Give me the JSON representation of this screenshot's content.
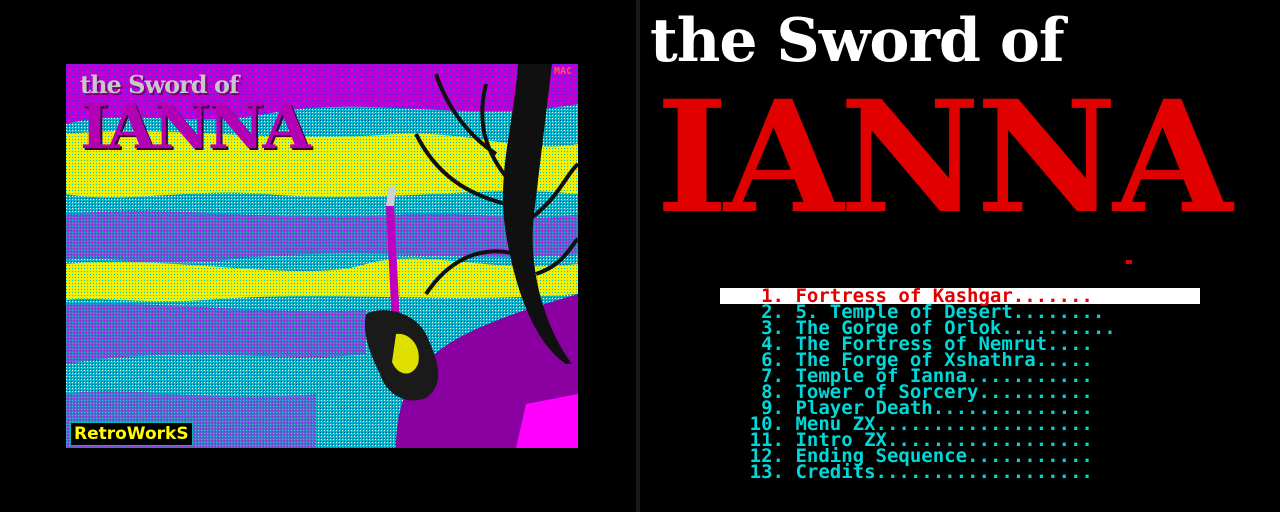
{
  "left_panel": {
    "art_title_small": "the Sword of",
    "art_title_big": "IANNA",
    "corner_mark": "MAC",
    "publisher_logo": "RetroWorkS"
  },
  "right_panel": {
    "title_top": "the Sword of",
    "title_main": "IANNA"
  },
  "menu": {
    "items": [
      {
        "num": "1.",
        "name": "Fortress of Kashgar",
        "dots": ".......",
        "selected": true
      },
      {
        "num": "2.",
        "name": "5. Temple of Desert",
        "dots": "........",
        "selected": false
      },
      {
        "num": "3.",
        "name": "The Gorge of Orlok",
        "dots": "..........",
        "selected": false
      },
      {
        "num": "4.",
        "name": "The Fortress of Nemrut",
        "dots": "....",
        "selected": false
      },
      {
        "num": "6.",
        "name": "The Forge of Xshathra",
        "dots": ".....",
        "selected": false
      },
      {
        "num": "7.",
        "name": "Temple of Ianna",
        "dots": "...........",
        "selected": false
      },
      {
        "num": "8.",
        "name": "Tower of Sorcery",
        "dots": "..........",
        "selected": false
      },
      {
        "num": "9.",
        "name": "Player Death",
        "dots": "..............",
        "selected": false
      },
      {
        "num": "10.",
        "name": "Menu ZX",
        "dots": "...................",
        "selected": false
      },
      {
        "num": "11.",
        "name": "Intro ZX",
        "dots": "..................",
        "selected": false
      },
      {
        "num": "12.",
        "name": "Ending Sequence",
        "dots": "...........",
        "selected": false
      },
      {
        "num": "13.",
        "name": "Credits",
        "dots": "...................",
        "selected": false
      }
    ]
  },
  "colors": {
    "background": "#000000",
    "title_red": "#e00000",
    "menu_cyan": "#00d8d8",
    "selection_bg": "#ffffff",
    "art_magenta": "#d400d4",
    "art_yellow": "#ffff00",
    "art_cyan": "#00c8c8"
  }
}
